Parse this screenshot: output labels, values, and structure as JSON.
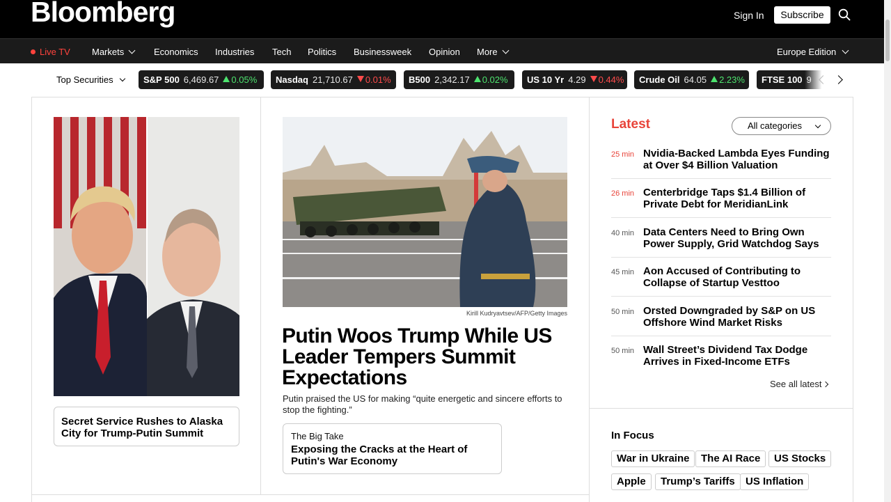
{
  "header": {
    "logo": "Bloomberg",
    "sign_in": "Sign In",
    "subscribe": "Subscribe"
  },
  "nav": {
    "live": "Live TV",
    "items": [
      "Markets",
      "Economics",
      "Industries",
      "Tech",
      "Politics",
      "Businessweek",
      "Opinion",
      "More"
    ],
    "edition": "Europe Edition"
  },
  "tickers": {
    "label": "Top Securities",
    "items": [
      {
        "name": "S&P 500",
        "value": "6,469.67",
        "change": "0.05%",
        "dir": "up"
      },
      {
        "name": "Nasdaq",
        "value": "21,710.67",
        "change": "0.01%",
        "dir": "down"
      },
      {
        "name": "B500",
        "value": "2,342.17",
        "change": "0.02%",
        "dir": "up"
      },
      {
        "name": "US 10 Yr",
        "value": "4.29",
        "change": "0.44%",
        "dir": "down"
      },
      {
        "name": "Crude Oil",
        "value": "64.05",
        "change": "2.23%",
        "dir": "up"
      },
      {
        "name": "FTSE 100",
        "value": "9",
        "change": "",
        "dir": ""
      }
    ]
  },
  "left": {
    "card_title": "Secret Service Rushes to Alaska City for Trump-Putin Summit"
  },
  "main": {
    "credit": "Kirill Kudryavtsev/AFP/Getty Images",
    "headline": "Putin Woos Trump While US Leader Tempers Summit Expectations",
    "summary": "Putin praised the US for making “quite energetic and sincere efforts to stop the fighting.”",
    "bigtake_kicker": "The Big Take",
    "bigtake_title": "Exposing the Cracks at the Heart of Putin's War Economy"
  },
  "latest": {
    "title": "Latest",
    "category": "All categories",
    "stories": [
      {
        "time": "25 min",
        "title": "Nvidia-Backed Lambda Eyes Funding at Over $4 Billion Valuation"
      },
      {
        "time": "26 min",
        "title": "Centerbridge Taps $1.4 Billion of Private Debt for MeridianLink"
      },
      {
        "time": "40 min",
        "title": "Data Centers Need to Bring Own Power Supply, Grid Watchdog Says"
      },
      {
        "time": "45 min",
        "title": "Aon Accused of Contributing to Collapse of Startup Vesttoo"
      },
      {
        "time": "50 min",
        "title": "Orsted Downgraded by S&P on US Offshore Wind Market Risks"
      },
      {
        "time": "50 min",
        "title": "Wall Street’s Dividend Tax Dodge Arrives in Fixed-Income ETFs"
      }
    ],
    "see_all": "See all latest"
  },
  "focus": {
    "title": "In Focus",
    "tags": [
      "War in Ukraine",
      "The AI Race",
      "US Stocks",
      "Apple",
      "Trump’s Tariffs",
      "US Inflation"
    ]
  },
  "colors": {
    "accent": "#e8443a",
    "up": "#4de36e",
    "down": "#ff4b4b",
    "bar": "#000000"
  }
}
